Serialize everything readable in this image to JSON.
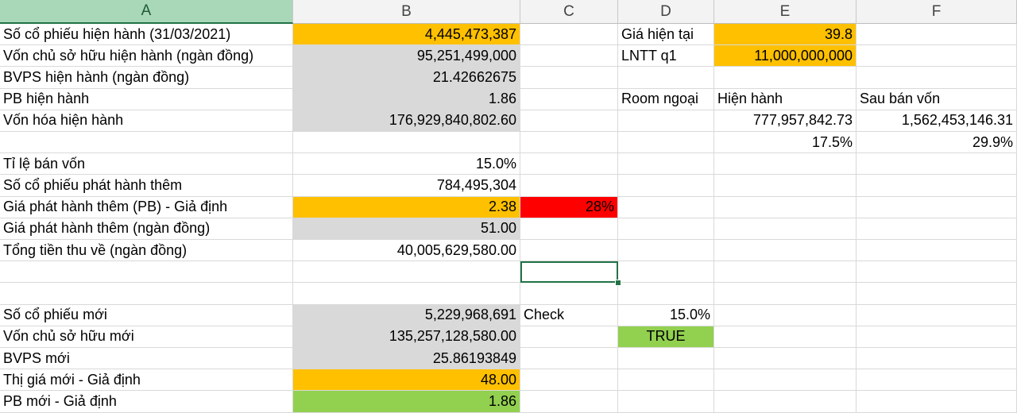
{
  "colors": {
    "orange": "#ffc000",
    "gray": "#d9d9d9",
    "red": "#ff0000",
    "green": "#92d050",
    "white": "#ffffff"
  },
  "sheet": {
    "columns": [
      {
        "label": "A",
        "selected": true
      },
      {
        "label": "B",
        "selected": false
      },
      {
        "label": "C",
        "selected": false
      },
      {
        "label": "D",
        "selected": false
      },
      {
        "label": "E",
        "selected": false
      },
      {
        "label": "F",
        "selected": false
      }
    ],
    "active_cell": "C13",
    "cells": [
      {
        "ref": "A2",
        "text": "Số cổ phiếu hiện hành (31/03/2021)",
        "align": "l"
      },
      {
        "ref": "B2",
        "text": "4,445,473,387",
        "align": "r",
        "fill": "orange"
      },
      {
        "ref": "D2",
        "text": "Giá hiện tại",
        "align": "l"
      },
      {
        "ref": "E2",
        "text": "39.8",
        "align": "r",
        "fill": "orange"
      },
      {
        "ref": "A3",
        "text": "Vốn chủ sở hữu hiện hành (ngàn đồng)",
        "align": "l"
      },
      {
        "ref": "B3",
        "text": "95,251,499,000",
        "align": "r",
        "fill": "gray"
      },
      {
        "ref": "D3",
        "text": "LNTT q1",
        "align": "l"
      },
      {
        "ref": "E3",
        "text": "11,000,000,000",
        "align": "r",
        "fill": "orange"
      },
      {
        "ref": "A4",
        "text": "BVPS hiện hành (ngàn đồng)",
        "align": "l"
      },
      {
        "ref": "B4",
        "text": "21.42662675",
        "align": "r",
        "fill": "gray"
      },
      {
        "ref": "A5",
        "text": "PB hiện hành",
        "align": "l"
      },
      {
        "ref": "B5",
        "text": "1.86",
        "align": "r",
        "fill": "gray"
      },
      {
        "ref": "D5",
        "text": "Room ngoại",
        "align": "l"
      },
      {
        "ref": "E5",
        "text": "Hiện hành",
        "align": "l"
      },
      {
        "ref": "F5",
        "text": "Sau bán vốn",
        "align": "l"
      },
      {
        "ref": "A6",
        "text": "Vốn hóa hiện hành",
        "align": "l"
      },
      {
        "ref": "B6",
        "text": "176,929,840,802.60",
        "align": "r",
        "fill": "gray"
      },
      {
        "ref": "E6",
        "text": "777,957,842.73",
        "align": "r"
      },
      {
        "ref": "F6",
        "text": "1,562,453,146.31",
        "align": "r"
      },
      {
        "ref": "E7",
        "text": "17.5%",
        "align": "r"
      },
      {
        "ref": "F7",
        "text": "29.9%",
        "align": "r"
      },
      {
        "ref": "A8",
        "text": "Tỉ lệ bán vốn",
        "align": "l"
      },
      {
        "ref": "B8",
        "text": "15.0%",
        "align": "r"
      },
      {
        "ref": "A9",
        "text": "Số cổ phiếu phát hành thêm",
        "align": "l"
      },
      {
        "ref": "B9",
        "text": "784,495,304",
        "align": "r"
      },
      {
        "ref": "A10",
        "text": "Giá phát hành thêm (PB) - Giả định",
        "align": "l"
      },
      {
        "ref": "B10",
        "text": "2.38",
        "align": "r",
        "fill": "orange"
      },
      {
        "ref": "C10",
        "text": "28%",
        "align": "r",
        "fill": "red"
      },
      {
        "ref": "A11",
        "text": "Giá phát hành thêm (ngàn đồng)",
        "align": "l"
      },
      {
        "ref": "B11",
        "text": "51.00",
        "align": "r",
        "fill": "gray"
      },
      {
        "ref": "A12",
        "text": "Tổng tiền thu về (ngàn đồng)",
        "align": "l"
      },
      {
        "ref": "B12",
        "text": "40,005,629,580.00",
        "align": "r"
      },
      {
        "ref": "A15",
        "text": "Số cổ phiếu mới",
        "align": "l"
      },
      {
        "ref": "B15",
        "text": "5,229,968,691",
        "align": "r",
        "fill": "gray"
      },
      {
        "ref": "C15",
        "text": "Check",
        "align": "l"
      },
      {
        "ref": "D15",
        "text": "15.0%",
        "align": "r"
      },
      {
        "ref": "A16",
        "text": "Vốn chủ sở hữu mới",
        "align": "l"
      },
      {
        "ref": "B16",
        "text": "135,257,128,580.00",
        "align": "r",
        "fill": "gray"
      },
      {
        "ref": "D16",
        "text": "TRUE",
        "align": "c",
        "fill": "green"
      },
      {
        "ref": "A17",
        "text": "BVPS mới",
        "align": "l"
      },
      {
        "ref": "B17",
        "text": "25.86193849",
        "align": "r",
        "fill": "gray"
      },
      {
        "ref": "A18",
        "text": "Thị giá mới - Giả định",
        "align": "l"
      },
      {
        "ref": "B18",
        "text": "48.00",
        "align": "r",
        "fill": "orange"
      },
      {
        "ref": "A19",
        "text": "PB mới  - Giả định",
        "align": "l"
      },
      {
        "ref": "B19",
        "text": "1.86",
        "align": "r",
        "fill": "green"
      }
    ]
  }
}
